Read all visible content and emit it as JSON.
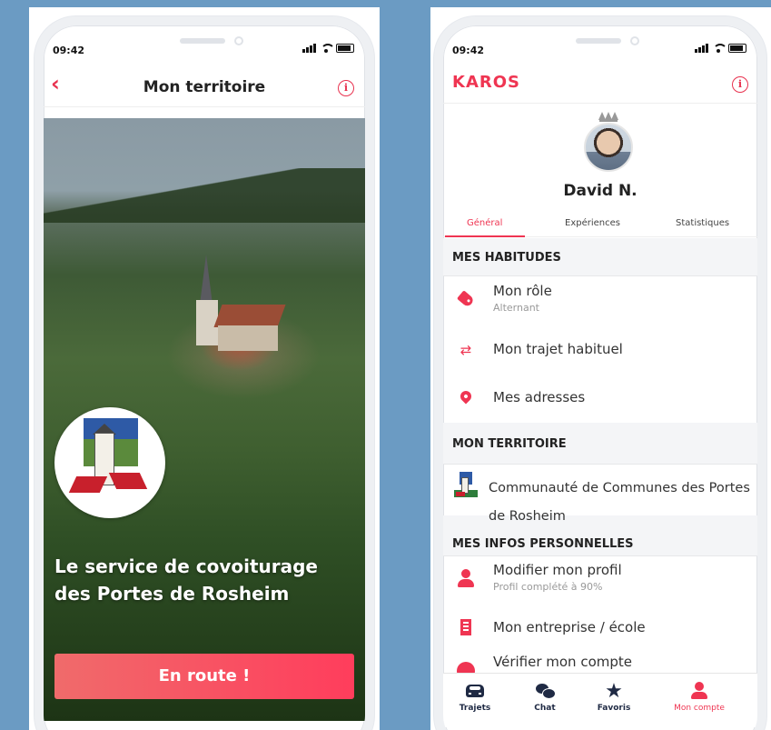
{
  "left_screen": {
    "status_time": "09:42",
    "header_title": "Mon territoire",
    "back_icon": "chevron-left-icon",
    "info_icon": "info-icon",
    "hero_text": "Le service de covoiturage des Portes de Rosheim",
    "cta_label": "En route !",
    "accent_color": "#ef3552"
  },
  "right_screen": {
    "status_time": "09:42",
    "brand": "KAROS",
    "user_name": "David N.",
    "tabs": [
      {
        "label": "Général",
        "active": true
      },
      {
        "label": "Expériences",
        "active": false
      },
      {
        "label": "Statistiques",
        "active": false
      }
    ],
    "sections": {
      "habitudes": {
        "title": "MES HABITUDES",
        "items": [
          {
            "label": "Mon rôle",
            "sub": "Alternant",
            "icon": "tag-icon"
          },
          {
            "label": "Mon trajet habituel",
            "icon": "swap-arrows-icon"
          },
          {
            "label": "Mes adresses",
            "icon": "map-pin-icon"
          }
        ]
      },
      "territoire": {
        "title": "MON TERRITOIRE",
        "line1": "Communauté de Communes des Portes",
        "line2": "de Rosheim"
      },
      "infos": {
        "title": "MES INFOS PERSONNELLES",
        "items": [
          {
            "label": "Modifier mon profil",
            "sub": "Profil complété à 90%",
            "icon": "person-icon"
          },
          {
            "label": "Mon entreprise / école",
            "icon": "building-icon"
          },
          {
            "label": "Vérifier mon compte",
            "icon": "verified-icon"
          }
        ]
      }
    },
    "bottom_nav": [
      {
        "label": "Trajets",
        "icon": "car-icon",
        "active": false
      },
      {
        "label": "Chat",
        "icon": "chat-icon",
        "active": false
      },
      {
        "label": "Favoris",
        "icon": "star-icon",
        "active": false
      },
      {
        "label": "Mon compte",
        "icon": "account-icon",
        "active": true
      }
    ]
  }
}
